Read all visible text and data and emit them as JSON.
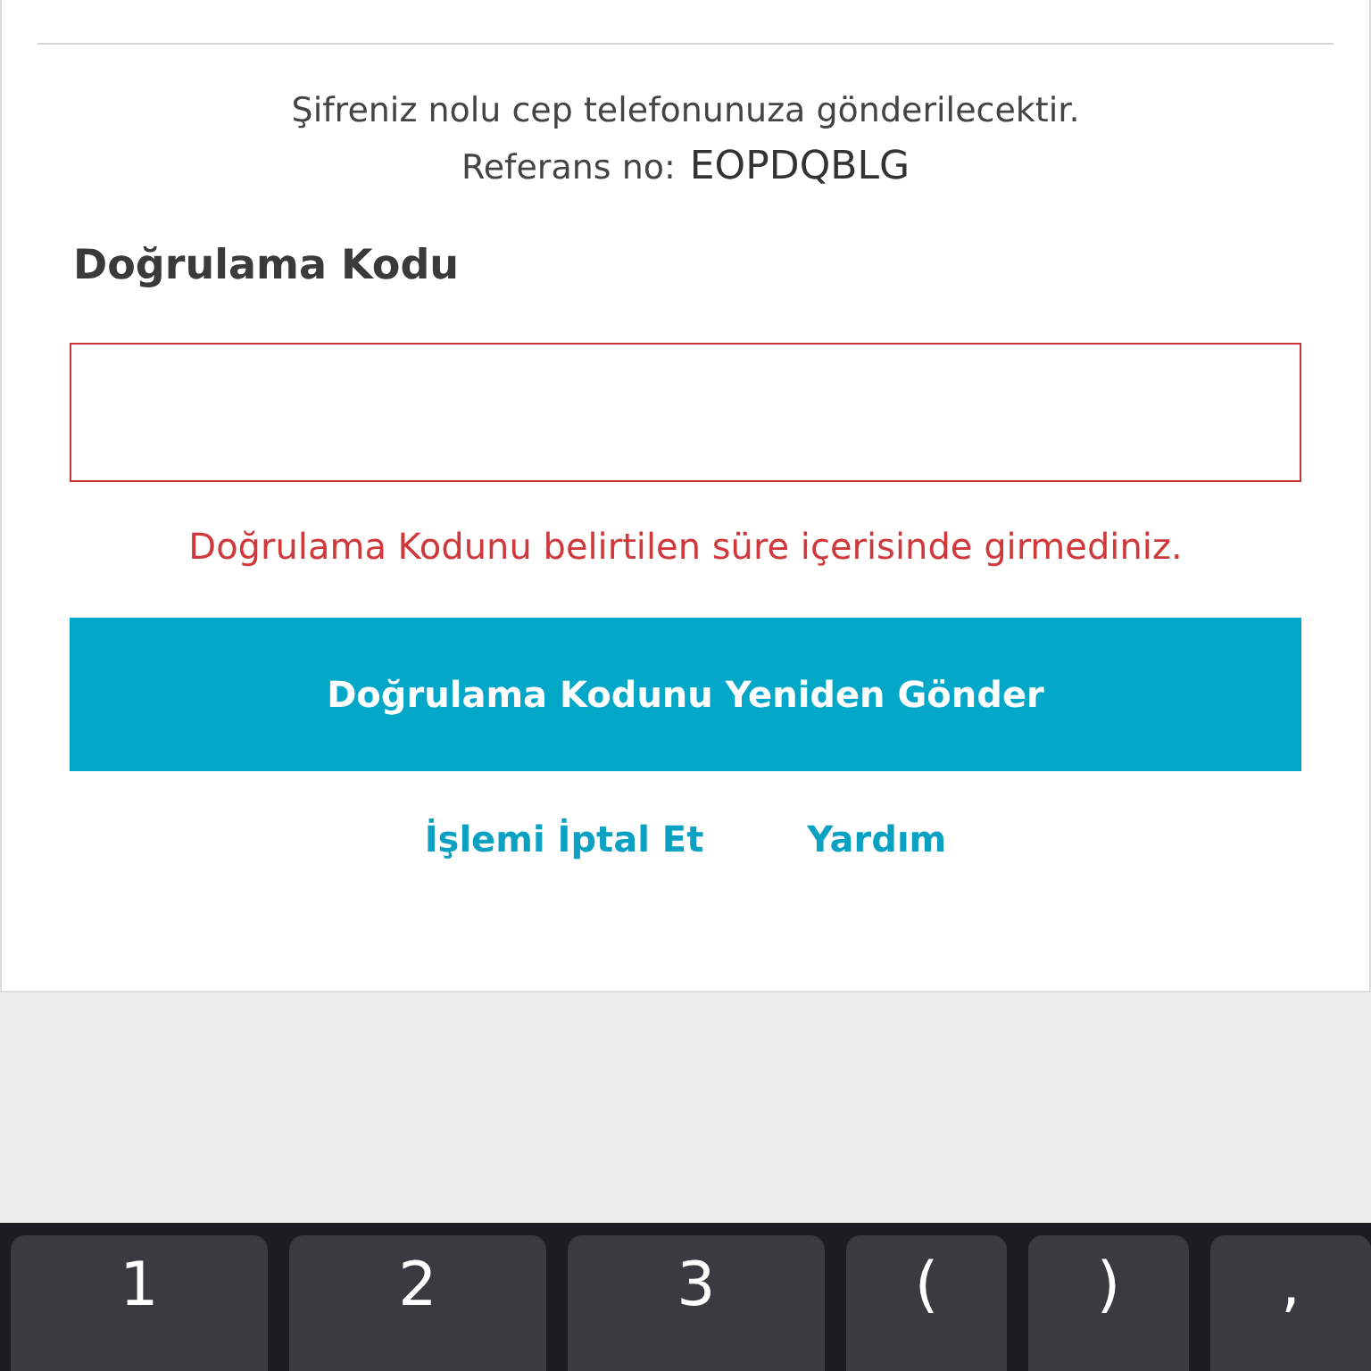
{
  "info": {
    "message": "Şifreniz nolu cep telefonunuza gönderilecektir.",
    "reference_label": "Referans no:",
    "reference_value": "EOPDQBLG"
  },
  "code_field": {
    "label": "Doğrulama Kodu",
    "invalid": true,
    "error": "Doğrulama Kodunu belirtilen süre içerisinde girmediniz."
  },
  "resend_button": "Doğrulama Kodunu Yeniden Gönder",
  "links": [
    "İşlemi İptal Et",
    "Yardım"
  ],
  "keyboard": {
    "keys": [
      {
        "label": "1",
        "kind": "digit"
      },
      {
        "label": "2",
        "kind": "digit"
      },
      {
        "label": "3",
        "kind": "digit"
      },
      {
        "label": "(",
        "kind": "symbol"
      },
      {
        "label": ")",
        "kind": "symbol"
      },
      {
        "label": ",",
        "kind": "symbol"
      }
    ]
  }
}
